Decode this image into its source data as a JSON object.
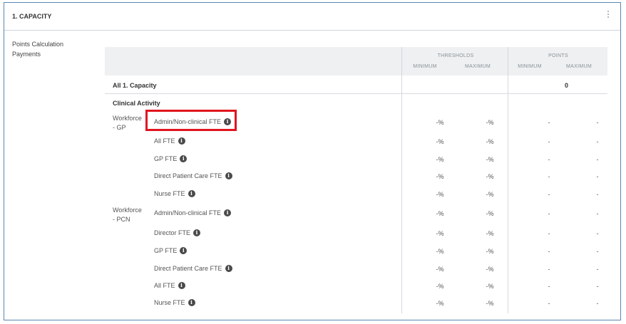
{
  "section": {
    "title": "1. CAPACITY"
  },
  "side_label": "Points Calculation Payments",
  "table": {
    "thresholds_label": "THRESHOLDS",
    "points_label": "POINTS",
    "min_label": "MINIMUM",
    "max_label": "MAXIMUM",
    "all_row_label": "All 1. Capacity",
    "all_row_points": "0",
    "subsection_label": "Clinical Activity",
    "groups": [
      {
        "label": "Workforce - GP"
      },
      {
        "label": "Workforce - PCN"
      }
    ],
    "rows": [
      {
        "label": "Admin/Non-clinical FTE",
        "t_min": "-%",
        "t_max": "-%",
        "p_min": "-",
        "p_max": "-"
      },
      {
        "label": "All FTE",
        "t_min": "-%",
        "t_max": "-%",
        "p_min": "-",
        "p_max": "-"
      },
      {
        "label": "GP FTE",
        "t_min": "-%",
        "t_max": "-%",
        "p_min": "-",
        "p_max": "-"
      },
      {
        "label": "Direct Patient Care FTE",
        "t_min": "-%",
        "t_max": "-%",
        "p_min": "-",
        "p_max": "-"
      },
      {
        "label": "Nurse FTE",
        "t_min": "-%",
        "t_max": "-%",
        "p_min": "-",
        "p_max": "-"
      },
      {
        "label": "Admin/Non-clinical FTE",
        "t_min": "-%",
        "t_max": "-%",
        "p_min": "-",
        "p_max": "-"
      },
      {
        "label": "Director FTE",
        "t_min": "-%",
        "t_max": "-%",
        "p_min": "-",
        "p_max": "-"
      },
      {
        "label": "GP FTE",
        "t_min": "-%",
        "t_max": "-%",
        "p_min": "-",
        "p_max": "-"
      },
      {
        "label": "Direct Patient Care FTE",
        "t_min": "-%",
        "t_max": "-%",
        "p_min": "-",
        "p_max": "-"
      },
      {
        "label": "All FTE",
        "t_min": "-%",
        "t_max": "-%",
        "p_min": "-",
        "p_max": "-"
      },
      {
        "label": "Nurse FTE",
        "t_min": "-%",
        "t_max": "-%",
        "p_min": "-",
        "p_max": "-"
      }
    ]
  },
  "colors": {
    "frame_border": "#5b86b3",
    "highlight": "#e0141e",
    "header_bg": "#eef0f2"
  },
  "icons": {
    "info": "info-icon",
    "menu": "kebab-menu-icon"
  }
}
